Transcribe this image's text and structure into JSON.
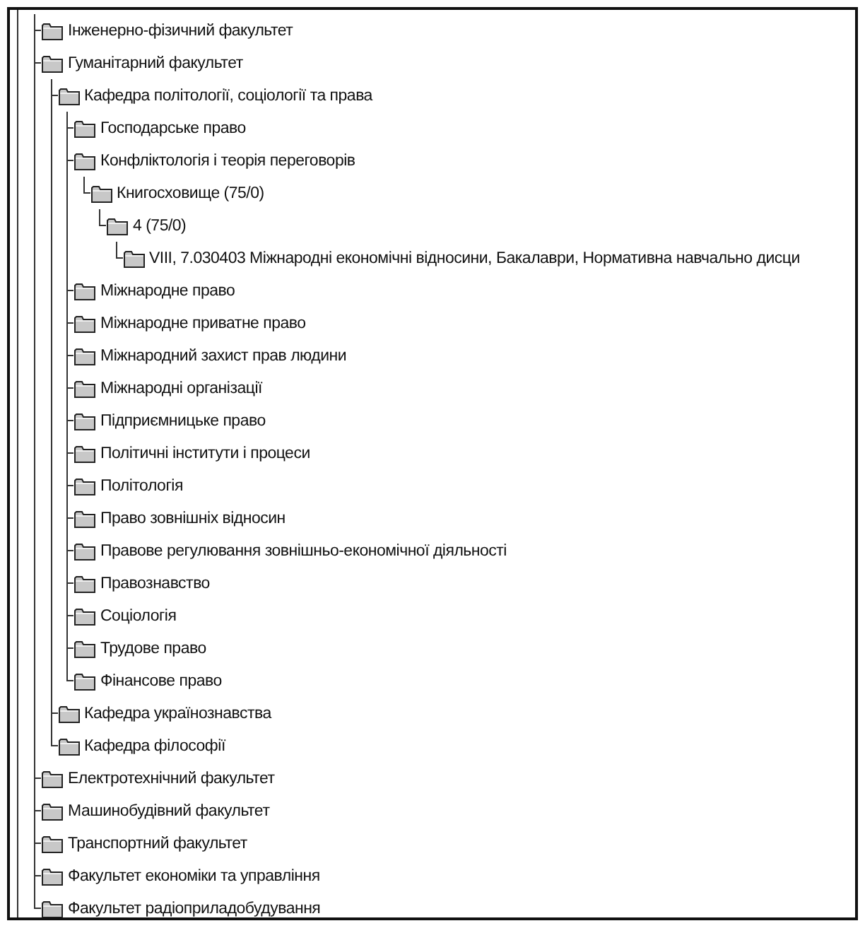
{
  "tree": [
    {
      "label": "Інженерно-фізичний факультет"
    },
    {
      "label": "Гуманітарний факультет",
      "children": [
        {
          "label": "Кафедра політології, соціології та права",
          "children": [
            {
              "label": "Господарське право"
            },
            {
              "label": "Конфліктологія і теорія переговорів",
              "children": [
                {
                  "label": "Книгосховище (75/0)",
                  "children": [
                    {
                      "label": "4 (75/0)",
                      "children": [
                        {
                          "label": "VIII,  7.030403 Міжнародні економічні відносини,  Бакалаври,  Нормативна навчально дисци"
                        }
                      ]
                    }
                  ]
                }
              ]
            },
            {
              "label": "Міжнародне право"
            },
            {
              "label": "Міжнародне приватне право"
            },
            {
              "label": "Міжнародний захист прав людини"
            },
            {
              "label": "Міжнародні організації"
            },
            {
              "label": "Підприємницьке право"
            },
            {
              "label": "Політичні інститути і процеси"
            },
            {
              "label": "Політологія"
            },
            {
              "label": "Право зовнішніх відносин"
            },
            {
              "label": "Правове регулювання зовнішньо-економічної діяльності"
            },
            {
              "label": "Правознавство"
            },
            {
              "label": "Соціологія"
            },
            {
              "label": "Трудове право"
            },
            {
              "label": "Фінансове право"
            }
          ]
        },
        {
          "label": "Кафедра українознавства"
        },
        {
          "label": "Кафедра філософії"
        }
      ]
    },
    {
      "label": "Електротехнічний факультет"
    },
    {
      "label": "Машинобудівний факультет"
    },
    {
      "label": "Транспортний факультет"
    },
    {
      "label": "Факультет економіки та управління"
    },
    {
      "label": "Факультет радіоприладобудування"
    }
  ]
}
